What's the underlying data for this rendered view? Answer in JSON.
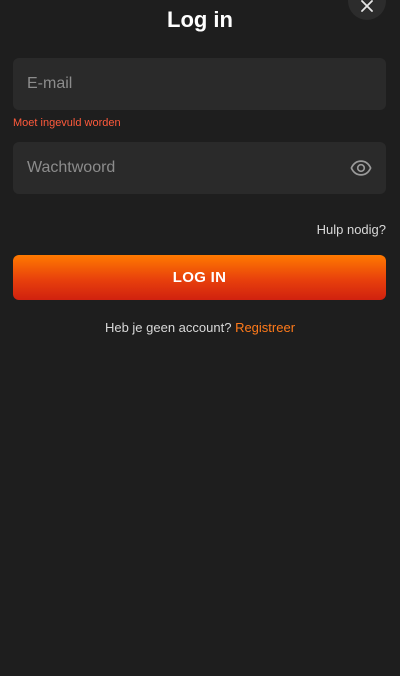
{
  "header": {
    "title": "Log in",
    "close_icon": "close-icon"
  },
  "form": {
    "email": {
      "placeholder": "E-mail",
      "value": "",
      "error": "Moet ingevuld worden"
    },
    "password": {
      "placeholder": "Wachtwoord",
      "value": "",
      "toggle_icon": "eye-icon"
    },
    "help_link": "Hulp nodig?",
    "submit_label": "LOG IN"
  },
  "register": {
    "prompt": "Heb je geen account?",
    "link": "Registreer"
  },
  "colors": {
    "background": "#1e1e1e",
    "field_bg": "#2a2a2a",
    "error": "#ff5a3c",
    "accent": "#ff7a1a",
    "button_gradient_top": "#ff7a00",
    "button_gradient_bottom": "#d0210f"
  }
}
